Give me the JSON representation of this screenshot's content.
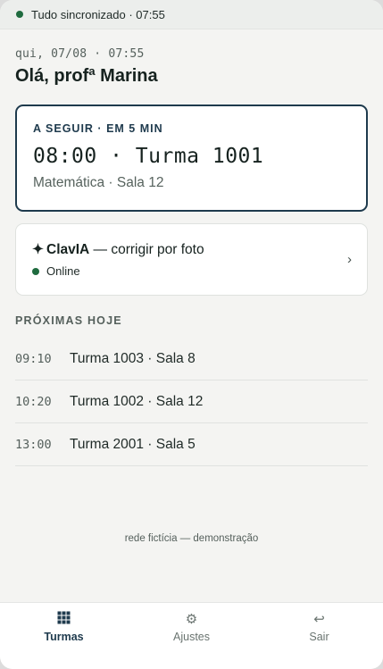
{
  "status": {
    "text": "Tudo sincronizado · 07:55",
    "indicator_color": "#1f6b3f"
  },
  "header": {
    "date": "qui, 07/08 · 07:55",
    "greeting": "Olá, profª Marina"
  },
  "next_class": {
    "kicker": "A SEGUIR · EM 5 MIN",
    "time_title": "08:00 · Turma 1001",
    "subtitle": "Matemática · Sala 12",
    "accent_color": "#1e3a4d"
  },
  "clavia": {
    "spark": "✦",
    "name": "ClavIA",
    "action": " — corrigir por foto",
    "status": "Online",
    "status_color": "#1f6b3f"
  },
  "upcoming": {
    "title": "PRÓXIMAS HOJE",
    "items": [
      {
        "time": "09:10",
        "label": "Turma 1003 · Sala 8"
      },
      {
        "time": "10:20",
        "label": "Turma 1002 · Sala 12"
      },
      {
        "time": "13:00",
        "label": "Turma 2001 · Sala 5"
      }
    ]
  },
  "footer_note": "rede fictícia — demonstração",
  "tabs": [
    {
      "label": "Turmas",
      "icon": "grid-icon",
      "active": true
    },
    {
      "label": "Ajustes",
      "icon": "gear-icon",
      "active": false
    },
    {
      "label": "Sair",
      "icon": "return-arrow-icon",
      "active": false
    }
  ]
}
